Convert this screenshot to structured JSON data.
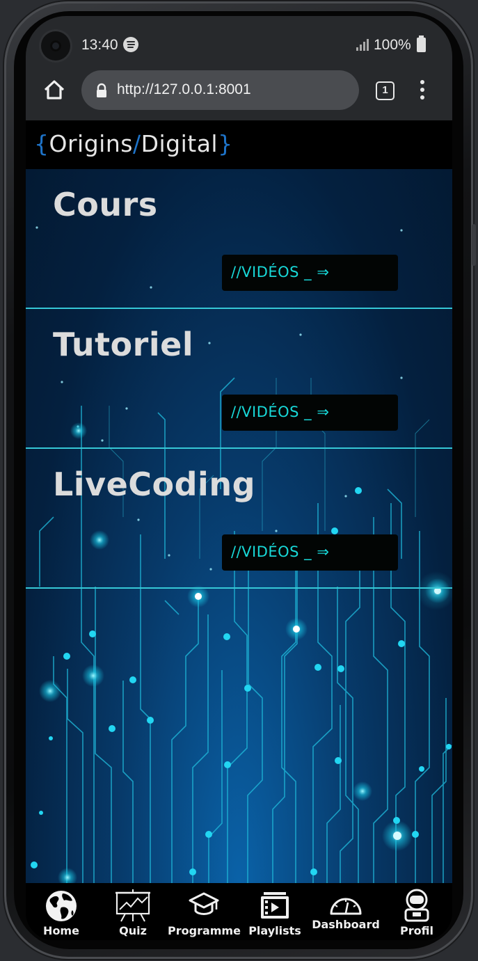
{
  "status_bar": {
    "time": "13:40",
    "battery": "100%",
    "icons": [
      "spotify-icon",
      "signal-icon",
      "battery-icon"
    ]
  },
  "browser": {
    "url": "http://127.0.0.1:8001",
    "tab_count": "1",
    "icons": [
      "home-icon",
      "lock-icon",
      "tabs-icon",
      "menu-icon"
    ]
  },
  "header": {
    "brace_open": "{",
    "logo_part1": "Origins",
    "slash": "/",
    "logo_part2": "Digital",
    "brace_close": "}"
  },
  "sections": [
    {
      "title": "Cours",
      "button_label": "//VIDÉOS _ ⇒"
    },
    {
      "title": "Tutoriel",
      "button_label": "//VIDÉOS _ ⇒"
    },
    {
      "title": "LiveCoding",
      "button_label": "//VIDÉOS _ ⇒"
    }
  ],
  "bottom_nav": [
    {
      "label": "Home",
      "icon": "globe-icon"
    },
    {
      "label": "Quiz",
      "icon": "presentation-chart-icon"
    },
    {
      "label": "Programme",
      "icon": "graduation-cap-icon"
    },
    {
      "label": "Playlists",
      "icon": "playlist-icon"
    },
    {
      "label": "Dashboard",
      "icon": "gauge-icon"
    },
    {
      "label": "Profil",
      "icon": "astronaut-icon"
    }
  ],
  "colors": {
    "accent_blue": "#1e73c8",
    "cyan": "#18d8d8",
    "divider": "#36c8d6",
    "background": "#04203f"
  }
}
